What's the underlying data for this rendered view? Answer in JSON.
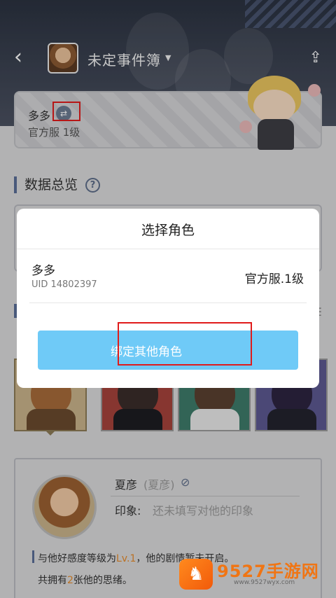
{
  "header": {
    "game_title": "未定事件簿",
    "back_icon": "chevron-left-icon",
    "share_icon": "share-icon",
    "caret_icon": "caret-down-icon"
  },
  "role_card": {
    "name": "多多",
    "server": "官方服 1级",
    "switch_icon": "swap-icon",
    "highlight_color": "#e01b1b"
  },
  "overview": {
    "title": "数据总览",
    "help_icon": "question-icon"
  },
  "character": {
    "name": "夏彦",
    "alias": "(夏彦)",
    "hide_icon": "eye-off-icon",
    "impression_label": "印象:",
    "impression_value": "还未填写对他的印象",
    "info_1_prefix": "与他好感度等级为",
    "info_1_level": "Lv.1",
    "info_1_suffix": "，他的剧情暂未开启。",
    "info_2_prefix": "共拥有",
    "info_2_count": "2",
    "info_2_suffix": "张他的思绪。"
  },
  "watermark": {
    "brand": "9527手游网",
    "url": "www.9527wyx.com"
  },
  "modal": {
    "title": "选择角色",
    "option": {
      "name": "多多",
      "uid": "UID 14802397",
      "server": "官方服.1级"
    },
    "bind_button": "绑定其他角色",
    "button_color": "#6fcaf7",
    "highlight_color": "#e01b1b"
  }
}
